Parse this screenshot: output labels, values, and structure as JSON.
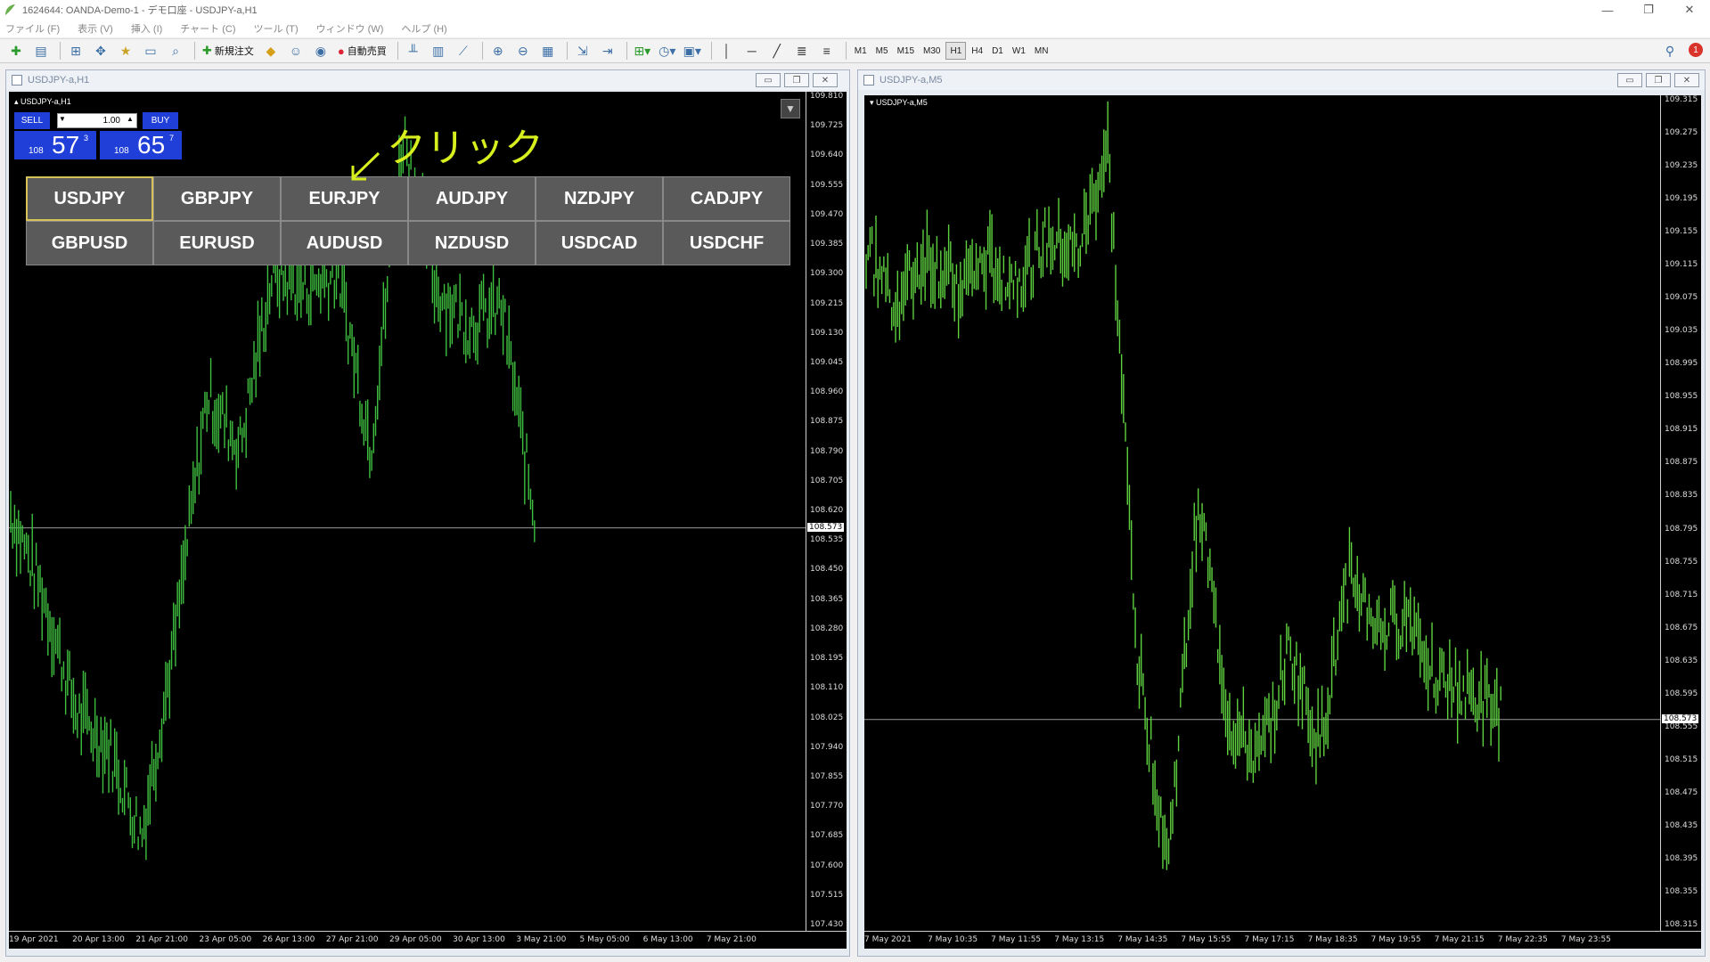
{
  "window": {
    "title": "1624644: OANDA-Demo-1 - デモ口座 - USDJPY-a,H1",
    "minimize": "—",
    "restore": "❐",
    "close": "✕"
  },
  "menu": [
    "ファイル (F)",
    "表示 (V)",
    "挿入 (I)",
    "チャート (C)",
    "ツール (T)",
    "ウィンドウ (W)",
    "ヘルプ (H)"
  ],
  "toolbar": {
    "new_order": "新規注文",
    "auto_trading": "自動売買",
    "timeframes": [
      "M1",
      "M5",
      "M15",
      "M30",
      "H1",
      "H4",
      "D1",
      "W1",
      "MN"
    ],
    "active_timeframe": "H1",
    "notification_count": "1",
    "icons": [
      "new-chart-icon",
      "profiles-icon",
      "market-watch-icon",
      "navigator-icon",
      "data-window-icon",
      "terminal-icon",
      "tester-icon",
      "new-order-icon",
      "metaeditor-icon",
      "auto-trading-icon",
      "bar-chart-icon",
      "candlestick-icon",
      "line-chart-icon",
      "zoom-in-icon",
      "zoom-out-icon",
      "tile-icon",
      "autoscroll-icon",
      "chart-shift-icon",
      "indicators-icon",
      "periods-icon",
      "templates-icon",
      "vertical-line-icon",
      "horizontal-line-icon",
      "trendline-icon",
      "channel-icon",
      "fibonacci-icon",
      "search-icon"
    ]
  },
  "left_window": {
    "title": "USDJPY-a,H1",
    "chart_label": "USDJPY-a,H1",
    "current_price": "108.573",
    "price_ticks": [
      "109.810",
      "109.725",
      "109.640",
      "109.555",
      "109.470",
      "109.385",
      "109.300",
      "109.215",
      "109.130",
      "109.045",
      "108.960",
      "108.875",
      "108.790",
      "108.705",
      "108.620",
      "108.535",
      "108.450",
      "108.365",
      "108.280",
      "108.195",
      "108.110",
      "108.025",
      "107.940",
      "107.855",
      "107.770",
      "107.685",
      "107.600",
      "107.515",
      "107.430"
    ],
    "time_ticks": [
      "19 Apr 2021",
      "20 Apr 13:00",
      "21 Apr 21:00",
      "23 Apr 05:00",
      "26 Apr 13:00",
      "27 Apr 21:00",
      "29 Apr 05:00",
      "30 Apr 13:00",
      "3 May 21:00",
      "5 May 05:00",
      "6 May 13:00",
      "7 May 21:00"
    ],
    "one_click": {
      "sell": "SELL",
      "buy": "BUY",
      "lot": "1.00",
      "sell_small": "108",
      "sell_big": "57",
      "sell_sup": "3",
      "buy_small": "108",
      "buy_big": "65",
      "buy_sup": "7"
    },
    "pairs": [
      "USDJPY",
      "GBPJPY",
      "EURJPY",
      "AUDJPY",
      "NZDJPY",
      "CADJPY",
      "GBPUSD",
      "EURUSD",
      "AUDUSD",
      "NZDUSD",
      "USDCAD",
      "USDCHF"
    ],
    "selected_pair": "USDJPY",
    "annotation": "クリック"
  },
  "right_window": {
    "title": "USDJPY-a,M5",
    "chart_label": "USDJPY-a,M5",
    "current_price": "108.573",
    "price_ticks": [
      "109.315",
      "109.275",
      "109.235",
      "109.195",
      "109.155",
      "109.115",
      "109.075",
      "109.035",
      "108.995",
      "108.955",
      "108.915",
      "108.875",
      "108.835",
      "108.795",
      "108.755",
      "108.715",
      "108.675",
      "108.635",
      "108.595",
      "108.555",
      "108.515",
      "108.475",
      "108.435",
      "108.395",
      "108.355",
      "108.315"
    ],
    "time_ticks": [
      "7 May 2021",
      "7 May 10:35",
      "7 May 11:55",
      "7 May 13:15",
      "7 May 14:35",
      "7 May 15:55",
      "7 May 17:15",
      "7 May 18:35",
      "7 May 19:55",
      "7 May 21:15",
      "7 May 22:35",
      "7 May 23:55"
    ]
  },
  "chart_data": [
    {
      "type": "line",
      "title": "USDJPY-a,H1",
      "color": "#3fbf3f",
      "ylim": [
        107.43,
        109.81
      ],
      "x": [
        "19 Apr 2021",
        "20 Apr 13:00",
        "21 Apr 21:00",
        "23 Apr 05:00",
        "26 Apr 13:00",
        "27 Apr 21:00",
        "29 Apr 05:00",
        "30 Apr 13:00",
        "3 May 21:00",
        "5 May 05:00",
        "6 May 13:00",
        "7 May 21:00"
      ],
      "values": [
        108.62,
        108.38,
        108.05,
        107.95,
        107.7,
        108.25,
        108.95,
        108.8,
        109.3,
        109.25,
        109.3,
        108.8,
        109.7,
        109.25,
        109.15,
        109.2,
        108.6
      ]
    },
    {
      "type": "line",
      "title": "USDJPY-a,M5",
      "color": "#5ed13f",
      "ylim": [
        108.315,
        109.335
      ],
      "x": [
        "7 May 2021",
        "7 May 10:35",
        "7 May 11:55",
        "7 May 13:15",
        "7 May 14:35",
        "7 May 15:55",
        "7 May 17:15",
        "7 May 18:35",
        "7 May 19:55",
        "7 May 21:15",
        "7 May 22:35",
        "7 May 23:55"
      ],
      "values": [
        109.15,
        109.08,
        109.14,
        109.1,
        109.13,
        109.11,
        109.16,
        109.14,
        109.27,
        108.64,
        108.4,
        108.85,
        108.57,
        108.52,
        108.66,
        108.54,
        108.75,
        108.68,
        108.7,
        108.62,
        108.6,
        108.58
      ]
    }
  ]
}
